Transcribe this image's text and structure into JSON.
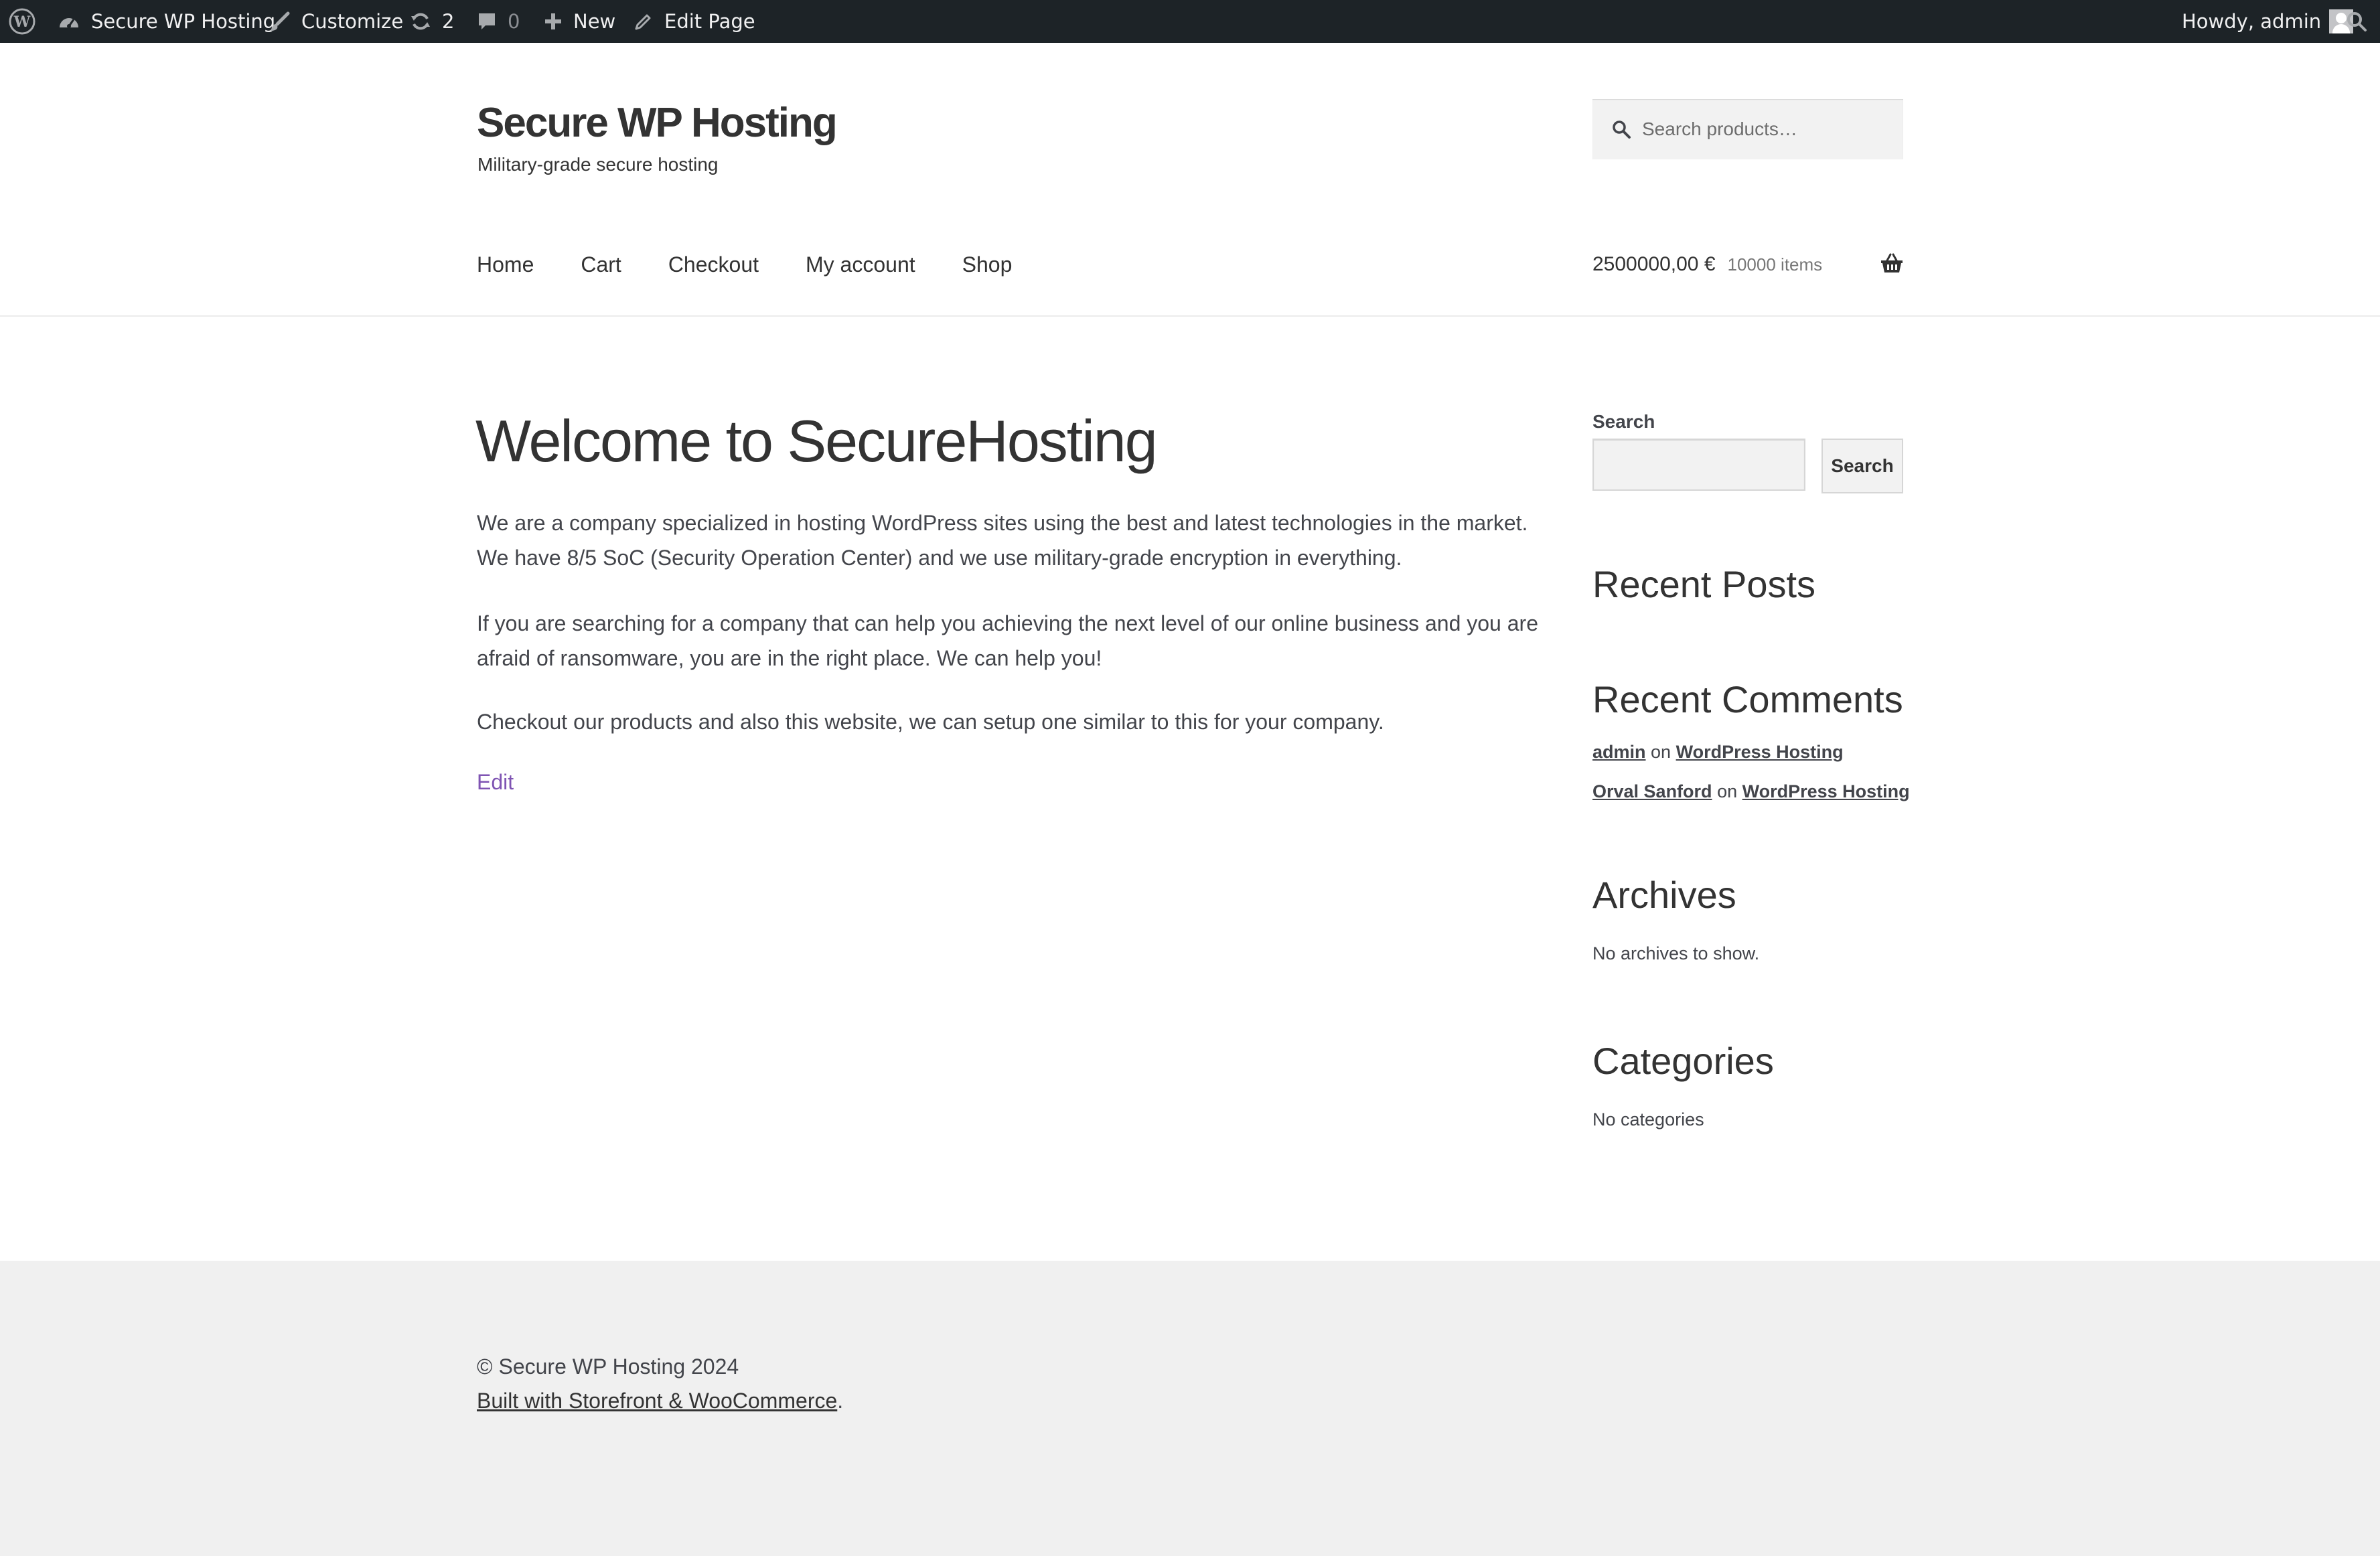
{
  "admin_bar": {
    "site_name": "Secure WP Hosting",
    "customize_label": "Customize",
    "updates_count": "2",
    "comments_count": "0",
    "new_label": "New",
    "edit_label": "Edit Page",
    "greeting": "Howdy, admin"
  },
  "header": {
    "site_title": "Secure WP Hosting",
    "site_description": "Military-grade secure hosting",
    "product_search_placeholder": "Search products…",
    "nav": [
      "Home",
      "Cart",
      "Checkout",
      "My account",
      "Shop"
    ],
    "cart_amount": "2500000,00 €",
    "cart_count": "10000 items"
  },
  "page": {
    "title": "Welcome to SecureHosting",
    "paragraphs": [
      "We are a company specialized in hosting WordPress sites using the best and latest technologies in the market. We have 8/5 SoC (Security Operation Center) and we use military-grade encryption in everything.",
      "If you are searching for a company that can help you achieving the next level of our online business and you are afraid of ransomware, you are in the right place. We can help you!",
      "Checkout our products and also this website, we can setup one similar to this for your company."
    ],
    "edit_link": "Edit"
  },
  "sidebar": {
    "search_label": "Search",
    "search_button": "Search",
    "recent_posts_title": "Recent Posts",
    "recent_comments_title": "Recent Comments",
    "comments": [
      {
        "author": "admin",
        "connector": "on",
        "post": "WordPress Hosting"
      },
      {
        "author": "Orval Sanford",
        "connector": "on",
        "post": "WordPress Hosting"
      }
    ],
    "archives_title": "Archives",
    "archives_empty": "No archives to show.",
    "categories_title": "Categories",
    "categories_empty": "No categories"
  },
  "footer": {
    "copyright": "© Secure WP Hosting 2024",
    "credit_link": "Built with Storefront & WooCommerce",
    "credit_suffix": "."
  },
  "colors": {
    "admin_bar_bg": "#1d2327",
    "accent_link": "#7f54b3",
    "footer_bg": "#f0f0f0"
  }
}
